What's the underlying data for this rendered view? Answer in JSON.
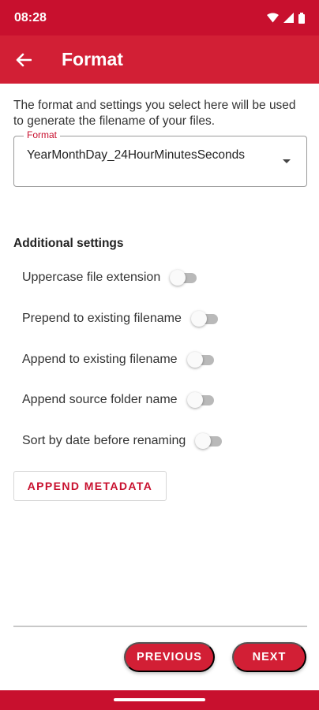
{
  "status_bar": {
    "time": "08:28",
    "icons": [
      "wifi-icon",
      "signal-icon",
      "battery-icon"
    ]
  },
  "app_bar": {
    "title": "Format",
    "back_icon": "arrow-left-icon"
  },
  "intro_text": "The format and settings you select here will be used to generate the filename of your files.",
  "format_field": {
    "label": "Format",
    "value": "YearMonthDay_24HourMinutesSeconds"
  },
  "additional_settings": {
    "title": "Additional settings",
    "toggles": [
      {
        "label": "Uppercase file extension",
        "on": false
      },
      {
        "label": "Prepend to existing filename",
        "on": false
      },
      {
        "label": "Append to existing filename",
        "on": false
      },
      {
        "label": "Append source folder name",
        "on": false
      },
      {
        "label": "Sort by date before renaming",
        "on": false
      }
    ]
  },
  "append_metadata_label": "APPEND METADATA",
  "footer": {
    "previous_label": "PREVIOUS",
    "next_label": "NEXT"
  },
  "colors": {
    "primary": "#d21f35",
    "status_bar": "#c8102e"
  }
}
